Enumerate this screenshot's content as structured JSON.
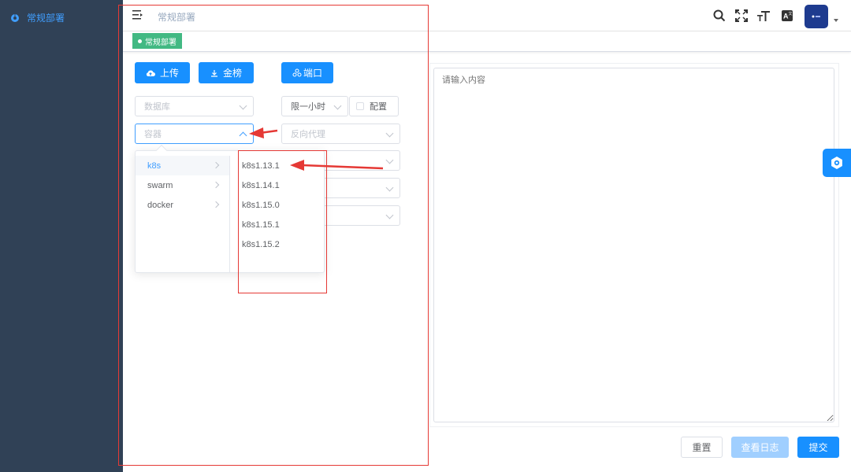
{
  "sidebar": {
    "items": [
      {
        "label": "常规部署",
        "icon": "dashboard-icon"
      }
    ]
  },
  "header": {
    "breadcrumb": "常规部署",
    "icons": [
      "menu-icon",
      "search-icon",
      "fullscreen-icon",
      "font-size-icon",
      "translate-icon"
    ]
  },
  "tags": [
    {
      "label": "常规部署",
      "color": "#42b983"
    }
  ],
  "toolbar": {
    "upload_label": "上传",
    "gold_label": "金榜",
    "port_label": "端口"
  },
  "form": {
    "database_placeholder": "数据库",
    "time_limit_value": "限一小时",
    "config_label": "配置",
    "container_placeholder": "容器",
    "reverse_proxy_placeholder": "反向代理"
  },
  "cascader": {
    "level1": [
      "k8s",
      "swarm",
      "docker"
    ],
    "level1_active": "k8s",
    "level2": [
      "k8s1.13.1",
      "k8s1.14.1",
      "k8s1.15.0",
      "k8s1.15.1",
      "k8s1.15.2"
    ]
  },
  "editor": {
    "placeholder": "请输入内容"
  },
  "footer": {
    "reset_label": "重置",
    "view_log_label": "查看日志",
    "submit_label": "提交"
  },
  "colors": {
    "sidebar_bg": "#304156",
    "primary": "#1890ff",
    "tag_green": "#42b983",
    "annotation_red": "#e53935"
  }
}
